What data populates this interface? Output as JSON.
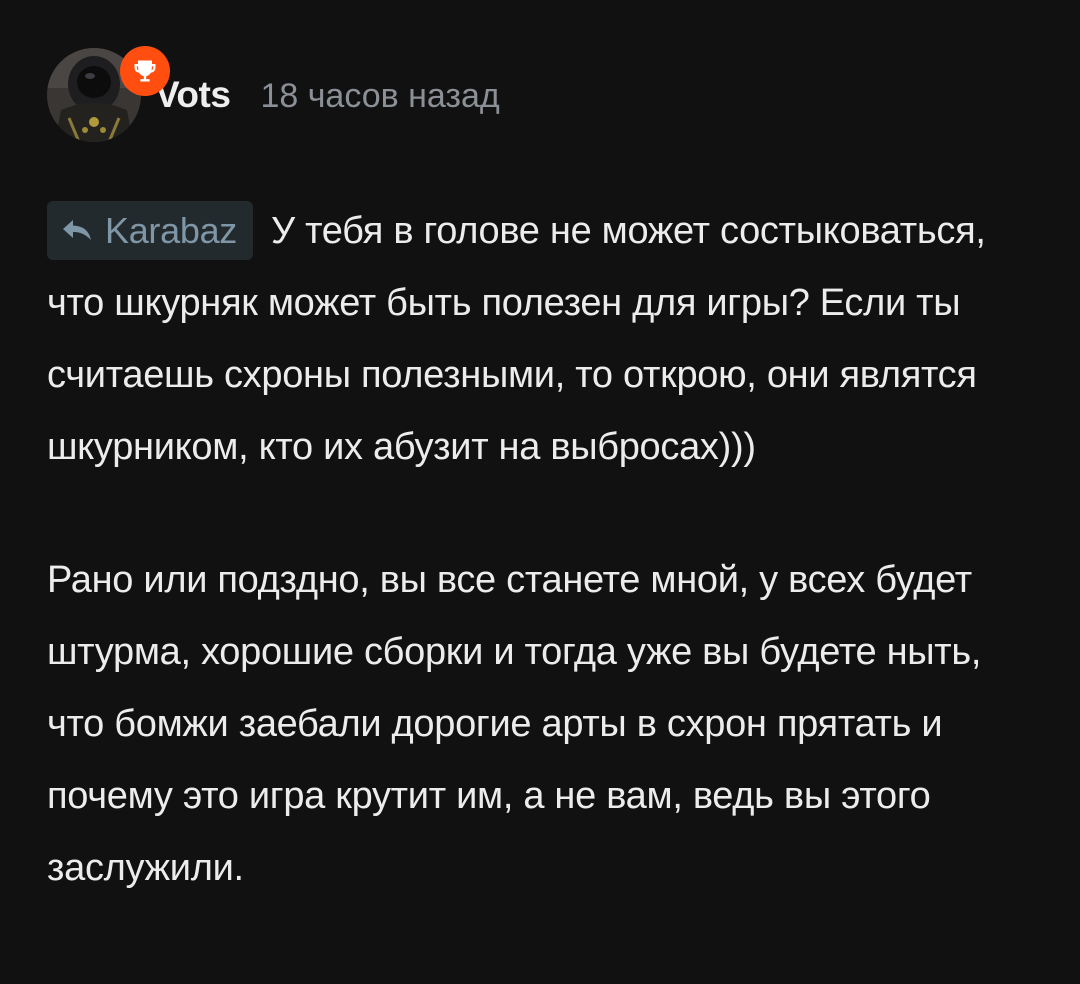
{
  "comment": {
    "author": {
      "name": "Vots",
      "avatar_icon": "avatar-image",
      "badge_icon": "trophy-icon",
      "badge_color": "#ff4e0f"
    },
    "timestamp": "18 часов назад",
    "reply_to": {
      "name": "Karabaz",
      "icon": "reply-arrow-icon"
    },
    "paragraphs": [
      "У тебя в голове не может состыковаться, что шкурняк может быть полезен для игры? Если ты считаешь схроны полезными, то открою, они являтся шкурником, кто их абузит на выбросах)))",
      "Рано или подздно, вы все станете мной, у всех будет штурма, хорошие сборки и тогда уже вы будете ныть, что бомжи заебали дорогие арты в схрон прятать и почему это игра крутит им, а не вам, ведь вы этого заслужили."
    ]
  }
}
